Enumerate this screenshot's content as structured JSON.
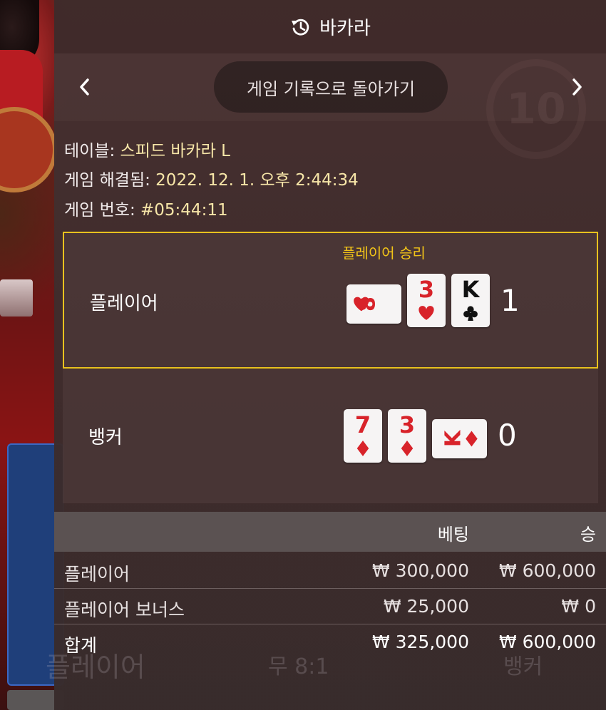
{
  "header": {
    "title": "바카라",
    "icon": "history-icon"
  },
  "nav": {
    "back_label": "게임 기록으로 돌아가기",
    "round_badge": "10",
    "prev_icon": "chevron-left-icon",
    "next_icon": "chevron-right-icon"
  },
  "info": {
    "table_label": "테이블: ",
    "table_value": "스피드 바카라 L",
    "resolved_label": "게임 해결됨: ",
    "resolved_value": "2022. 12. 1. 오후 2:44:34",
    "game_no_label": "게임 번호: ",
    "game_no_value": "#05:44:11"
  },
  "player": {
    "name": "플레이어",
    "winner_label": "플레이어 승리",
    "score": "1",
    "cards": [
      {
        "rank": "8",
        "suit": "heart",
        "color": "#d8232a",
        "rotated": true
      },
      {
        "rank": "3",
        "suit": "heart",
        "color": "#d8232a",
        "rotated": false
      },
      {
        "rank": "K",
        "suit": "club",
        "color": "#111111",
        "rotated": false
      }
    ]
  },
  "banker": {
    "name": "뱅커",
    "score": "0",
    "cards": [
      {
        "rank": "7",
        "suit": "diamond",
        "color": "#d8232a",
        "rotated": false
      },
      {
        "rank": "3",
        "suit": "diamond",
        "color": "#d8232a",
        "rotated": false
      },
      {
        "rank": "K",
        "suit": "diamond",
        "color": "#d8232a",
        "rotated": true
      }
    ]
  },
  "bets": {
    "headers": {
      "bet": "베팅",
      "win": "승"
    },
    "rows": [
      {
        "name": "플레이어",
        "bet": "₩ 300,000",
        "win": "₩ 600,000"
      },
      {
        "name": "플레이어 보너스",
        "bet": "₩ 25,000",
        "win": "₩ 0"
      }
    ],
    "total": {
      "name": "합계",
      "bet": "₩ 325,000",
      "win": "₩ 600,000"
    }
  },
  "background_ghost": {
    "left": "플레이어",
    "mid": "무 8:1",
    "right": "뱅커"
  },
  "colors": {
    "accent": "#e8c21e",
    "info_value": "#f7e6a8",
    "card_red": "#d8232a"
  }
}
